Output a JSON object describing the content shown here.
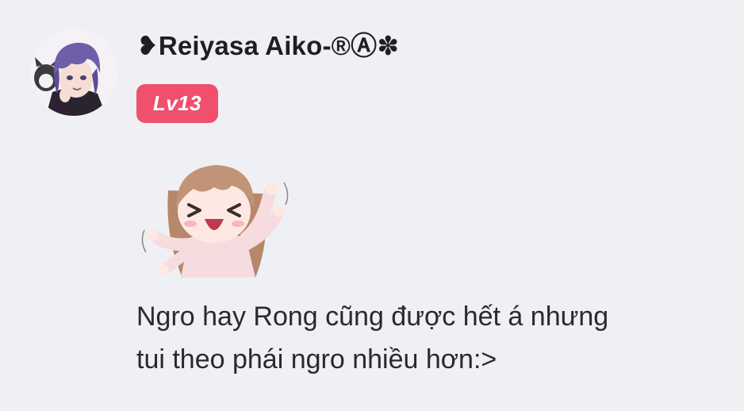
{
  "post": {
    "author": {
      "name": "❥Reiyasa Aiko-®Ⓐ✽",
      "level": "Lv13",
      "avatar_icon": "anime-character-avatar-icon"
    },
    "sticker_icon": "cheering-anime-girl-sticker-icon",
    "message_line_1": "Ngro hay Rong cũng được hết á nhưng",
    "message_line_2": "tui theo phái ngro nhiều hơn:>",
    "colors": {
      "background": "#eff0f4",
      "level_badge": "#f0506e",
      "text": "#222222"
    }
  }
}
